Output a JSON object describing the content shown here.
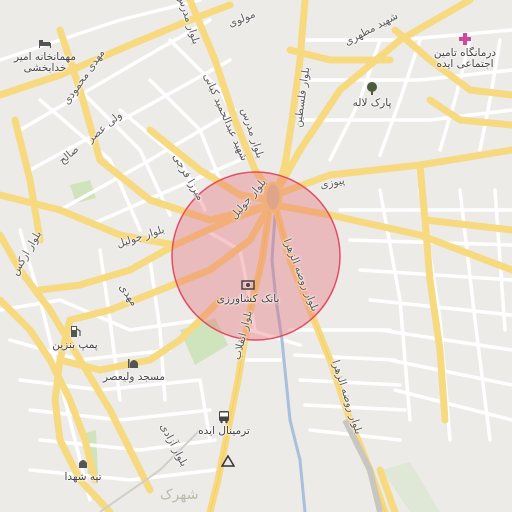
{
  "map": {
    "area_highlight_color": "#e8606e",
    "road_major_color": "#f8d77a",
    "road_minor_color": "#ffffff",
    "park_color": "#c9dfb5",
    "river_color": "#9fb8d8"
  },
  "roads": {
    "molavi": "مولوی",
    "shahid_motahari": "شهید مطهری",
    "bolvar_modares_top": "بلوار مدرس",
    "bolvar_modares": "بلوار مدرس",
    "bolvar_felestin": "بلوار فلسطین",
    "shahid_abdolhamid_kiani": "شهید عبدالحمید کیانی",
    "mirza_farhi": "میرزا فرجی",
    "mehdi_mahmoudi": "مهدی محمودی",
    "vali_asr": "ولی عصر",
    "salah": "صالح",
    "bolvar_jolil_1": "بلوار جولیل",
    "bolvar_jolil_2": "بلوار جولیل",
    "pouyazi": "پیوزی",
    "bolvar_arak": "بلوار ارکس",
    "mehdi": "مهدی",
    "bolvar_rowzeh_1": "بلوار روضه الزهرا",
    "bolvar_rowzeh_2": "بلوار روضه الزهرا",
    "bolvar_enghelab": "بلوار انقلاب",
    "bolvar_azadi": "بلوار آزادی"
  },
  "pois": {
    "hotel": {
      "label_1": "مهمانخانه امیر",
      "label_2": "خدابخشی",
      "icon": "hotel-icon"
    },
    "clinic": {
      "label_1": "درمانگاه تامین",
      "label_2": "اجتماعی ایده",
      "icon": "hospital-cross-icon"
    },
    "park": {
      "label": "پارک لاله",
      "icon": "tree-icon"
    },
    "bank": {
      "label": "بانک کشاورزی",
      "icon": "bank-icon"
    },
    "gas": {
      "label": "پمپ بنزین",
      "icon": "fuel-pump-icon"
    },
    "mosque": {
      "label": "مسجد ولیعصر",
      "icon": "mosque-icon"
    },
    "terminal": {
      "label": "ترمینال ایده",
      "icon": "bus-icon"
    },
    "hill": {
      "label": "تپه شهدا",
      "icon": "monument-icon"
    },
    "peak": {
      "label": "",
      "icon": "triangle-peak-icon"
    },
    "district": {
      "label": "شهرک"
    }
  }
}
